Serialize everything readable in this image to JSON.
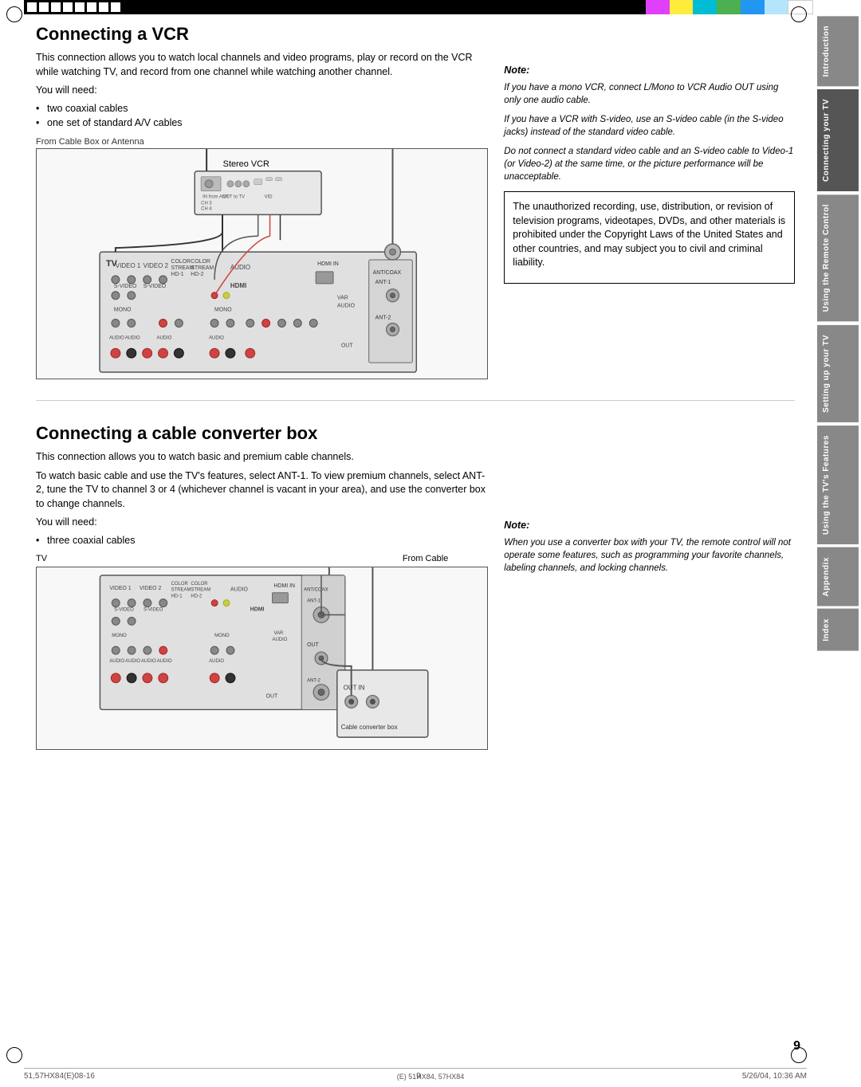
{
  "page": {
    "number": "9",
    "bottom_left": "51,57HX84(E)08-16",
    "bottom_center": "9",
    "bottom_right": "5/26/04, 10:36 AM",
    "bottom_model": "(E) 51HX84, 57HX84"
  },
  "sidebar": {
    "tabs": [
      {
        "id": "introduction",
        "label": "Introduction",
        "class": "tab-introduction"
      },
      {
        "id": "connecting",
        "label": "Connecting your TV",
        "class": "tab-connecting"
      },
      {
        "id": "using-remote",
        "label": "Using the Remote Control",
        "class": "tab-using-remote"
      },
      {
        "id": "setting-up",
        "label": "Setting up your TV",
        "class": "tab-setting-up"
      },
      {
        "id": "using-features",
        "label": "Using the TV's Features",
        "class": "tab-using-features"
      },
      {
        "id": "appendix",
        "label": "Appendix",
        "class": "tab-appendix"
      },
      {
        "id": "index",
        "label": "Index",
        "class": "tab-index"
      }
    ]
  },
  "section1": {
    "title": "Connecting a VCR",
    "intro": "This connection allows you to watch local channels and video programs, play or record on the VCR while watching TV, and record from one channel while watching another channel.",
    "you_will_need": "You will need:",
    "items": [
      "two coaxial cables",
      "one set of standard A/V cables"
    ],
    "diagram_label": "From Cable Box or Antenna",
    "diagram_label2": "Stereo VCR",
    "diagram_label3": "TV",
    "note_label": "Note:",
    "note1": "If you have a mono VCR, connect L/Mono to VCR Audio OUT using only one audio cable.",
    "note2": "If you have a VCR with S-video, use an S-video cable (in the S-video jacks) instead of the standard video cable.",
    "note3": "Do not connect a standard video cable and an S-video cable to Video-1 (or Video-2) at the same time, or the picture performance will be unacceptable.",
    "warning": "The unauthorized recording, use, distribution, or revision of television programs, videotapes, DVDs, and other materials is prohibited under the Copyright Laws of the United States and other countries, and may subject you to civil and criminal liability."
  },
  "section2": {
    "title": "Connecting a cable converter box",
    "intro": "This connection allows you to watch basic and premium cable channels.",
    "detail": "To watch basic cable and use the TV's features, select ANT-1. To view premium channels, select ANT-2, tune the TV to channel 3 or 4 (whichever channel is vacant in your area), and use the converter box to change channels.",
    "you_will_need": "You will need:",
    "items": [
      "three coaxial cables"
    ],
    "diagram_label_tv": "TV",
    "diagram_label_cable": "From Cable",
    "diagram_label_box": "Cable converter box",
    "diagram_out_in": "OUT  IN",
    "note_label": "Note:",
    "note1": "When you use a converter box with your TV, the remote control will not operate some features, such as programming your favorite channels, labeling channels, and locking channels."
  },
  "colors": {
    "magenta": "#e040fb",
    "yellow": "#ffeb3b",
    "cyan": "#00bcd4",
    "green": "#4caf50",
    "blue": "#2196f3",
    "light_blue": "#b3e5fc",
    "white": "#ffffff"
  }
}
